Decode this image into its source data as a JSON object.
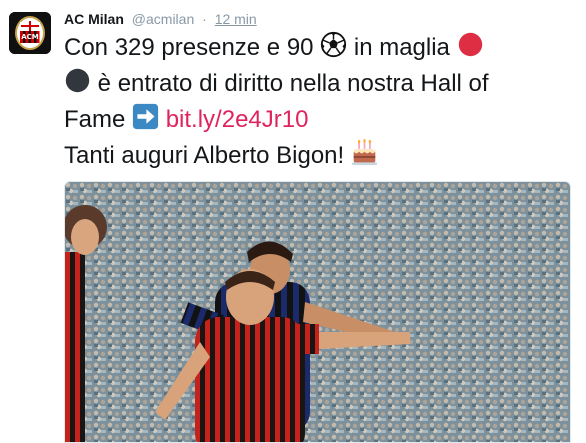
{
  "account": {
    "name": "AC Milan",
    "handle": "@acmilan",
    "separator": "·",
    "time": "12 min",
    "avatar_icon": "ac-milan-crest-icon"
  },
  "tweet": {
    "line1_a": "Con 329 presenze e 90",
    "line1_b": "in maglia",
    "line2": "è entrato di diritto nella nostra Hall of",
    "line3_a": "Fame",
    "link": "bit.ly/2e4Jr10",
    "line4": "Tanti auguri Alberto Bigon!",
    "emoji": [
      "soccer-ball-icon",
      "red-circle-icon",
      "black-circle-icon",
      "right-arrow-icon",
      "birthday-cake-icon"
    ]
  },
  "media": {
    "description_icon": "football-match-photo"
  },
  "colors": {
    "link": "#e0245e",
    "muted": "#8899a6",
    "text": "#14171a"
  }
}
